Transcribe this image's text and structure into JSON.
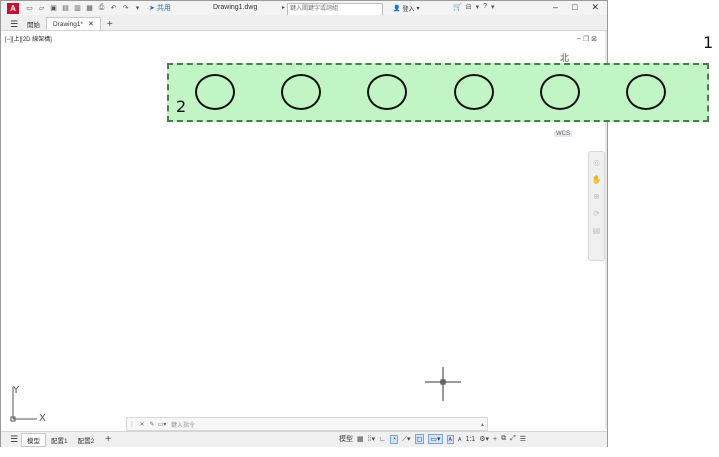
{
  "app": {
    "logo_letter": "A",
    "share_label": "共用",
    "doc_title": "Drawing1.dwg",
    "search_placeholder": "鍵入關鍵字或詞組",
    "login_label": "登入",
    "accent": "#c8102e"
  },
  "tabs": [
    {
      "label": "開始",
      "active": false
    },
    {
      "label": "Drawing1*",
      "active": true
    }
  ],
  "viewport": {
    "label": "[−][上][2D 線架構]",
    "compass_north": "北",
    "wcs_label": "WCS",
    "ucs_x": "X",
    "ucs_y": "Y"
  },
  "command_line": {
    "placeholder": "鍵入指令"
  },
  "status": {
    "layout_tabs": [
      "模型",
      "配置1",
      "配置2"
    ],
    "model_label": "模型",
    "scale_label": "1:1"
  },
  "annotations": {
    "label_1": "1",
    "label_2": "2",
    "box_color": "#c2f5c6",
    "circle_count": 6
  }
}
